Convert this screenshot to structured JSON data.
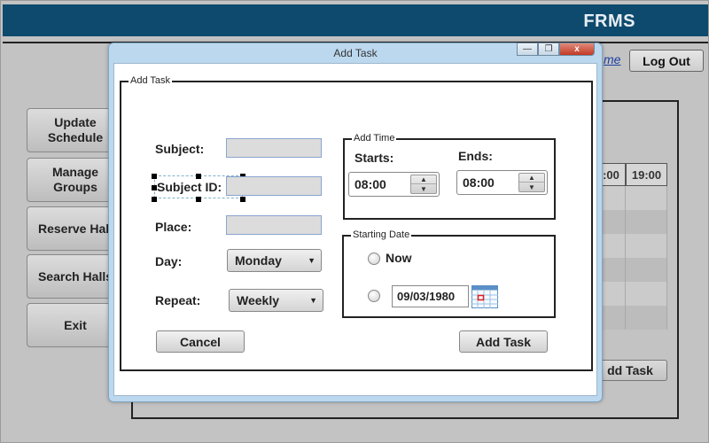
{
  "app": {
    "brand": "FRMS",
    "partial_link": "me",
    "logout_label": "Log Out"
  },
  "sidebar": {
    "items": [
      {
        "label": "Update Schedule"
      },
      {
        "label": "Manage Groups"
      },
      {
        "label": "Reserve Hall"
      },
      {
        "label": "Search Halls"
      },
      {
        "label": "Exit"
      }
    ]
  },
  "schedule_grid": {
    "columns": [
      ":00",
      "19:00"
    ]
  },
  "background_addtask_label": "dd Task",
  "dialog": {
    "title": "Add Task",
    "controls": {
      "minimize": "—",
      "maximize": "❐",
      "close": "x"
    },
    "group_title": "Add Task",
    "subject": {
      "label": "Subject:",
      "value": ""
    },
    "subject_id": {
      "label": "Subject ID:",
      "value": ""
    },
    "place": {
      "label": "Place:",
      "value": ""
    },
    "day": {
      "label": "Day:",
      "selected": "Monday"
    },
    "repeat": {
      "label": "Repeat:",
      "selected": "Weekly"
    },
    "cancel_label": "Cancel",
    "submit_label": "Add Task",
    "add_time": {
      "title": "Add Time",
      "starts_label": "Starts:",
      "starts_value": "08:00",
      "ends_label": "Ends:",
      "ends_value": "08:00"
    },
    "starting_date": {
      "title": "Starting Date",
      "now_label": "Now",
      "date_value": "09/03/1980"
    }
  },
  "colors": {
    "header_bg": "#0e4a6d",
    "dialog_border": "#bcd8ee",
    "field_bg": "#dcdcdc",
    "close_button": "#c23a25"
  }
}
